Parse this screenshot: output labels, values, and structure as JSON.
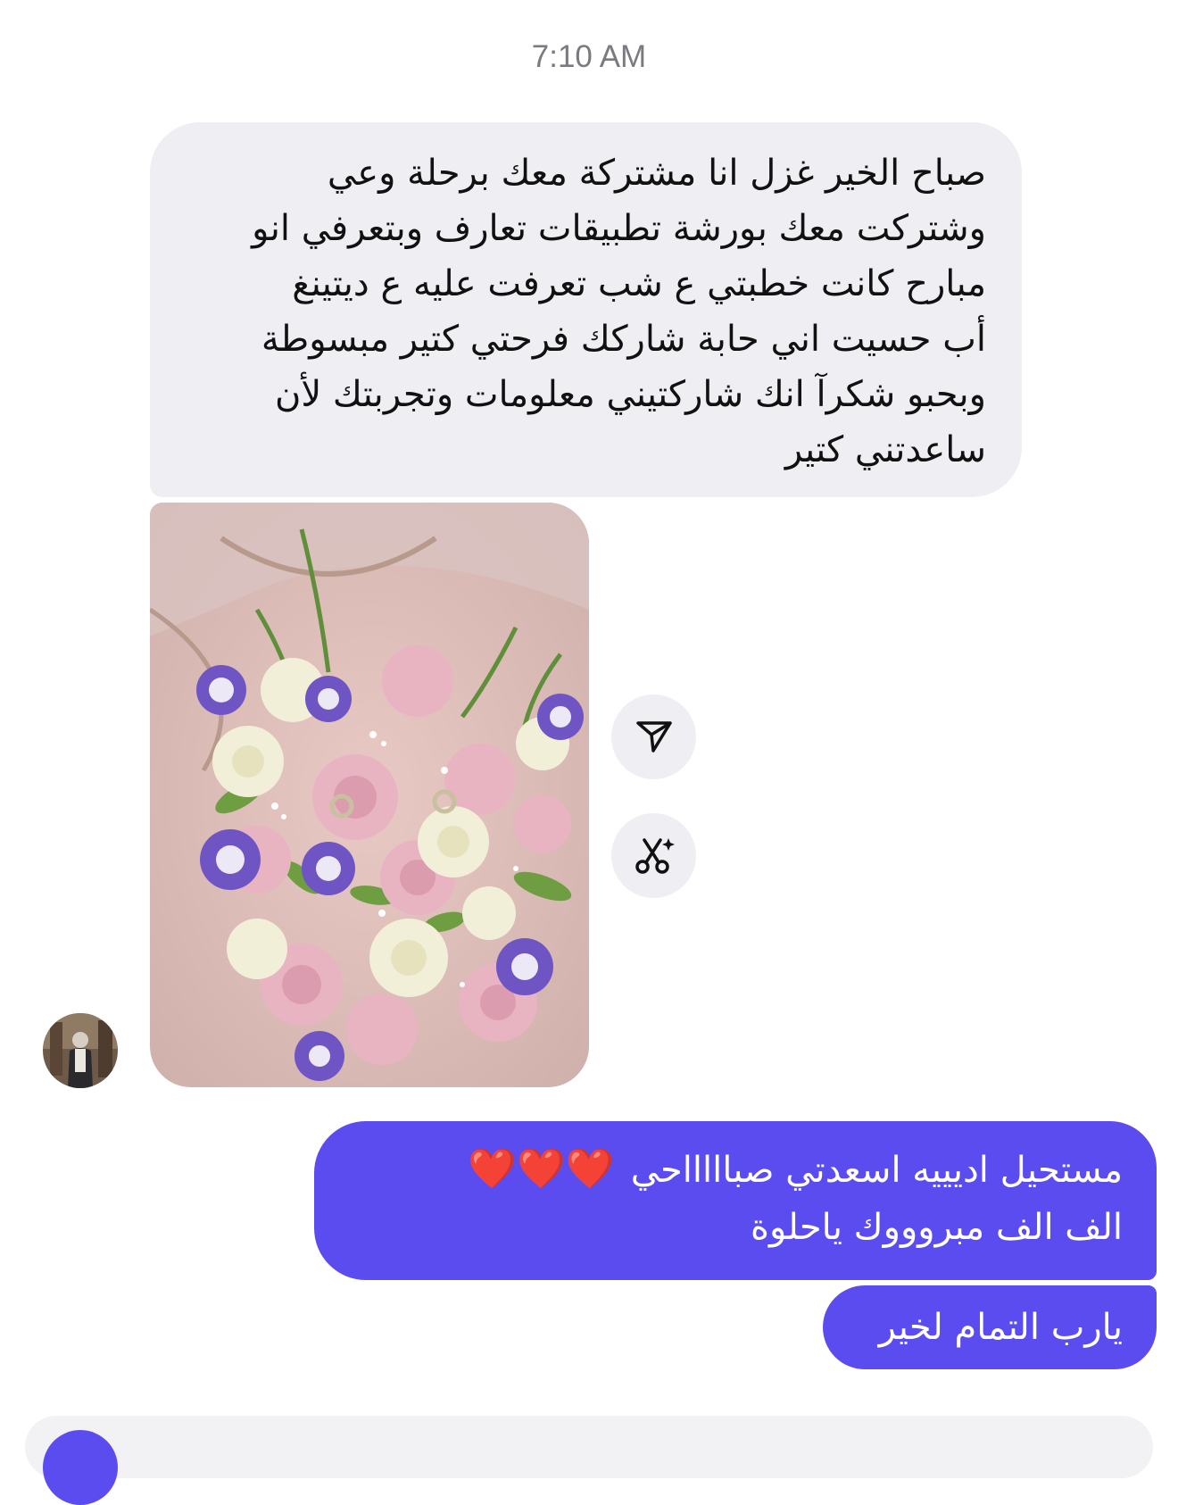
{
  "chat": {
    "timestamp": "7:10 AM",
    "incoming_message": {
      "lines": [
        "صباح الخير غزل انا مشتركة معك برحلة وعي",
        "وشتركت معك بورشة تطبيقات تعارف وبتعرفي انو",
        "مبارح كانت خطبتي ع شب تعرفت عليه ع ديتينغ",
        "أب حسيت اني حابة شاركك فرحتي كتير مبسوطة",
        "وبحبو شكرآ انك شاركتيني معلومات وتجربتك لأن",
        "ساعدتني كتير"
      ]
    },
    "incoming_photo": {
      "description_icon": "flower-bouquet-photo"
    },
    "actions": {
      "share_icon": "paper-plane-icon",
      "remix_icon": "scissors-sparkle-icon"
    },
    "sender_avatar_icon": "profile-avatar",
    "outgoing_messages": [
      {
        "line1": "مستحيل اديييه اسعدتي صباااااحي",
        "hearts": "❤️❤️❤️",
        "line2": "الف الف مبروووك ياحلوة"
      },
      {
        "text": "يارب التمام لخير"
      }
    ],
    "colors": {
      "outgoing_bubble": "#5b4cf0",
      "incoming_bubble": "#efeff3",
      "timestamp": "#7a7a80",
      "heart": "#e8291d"
    }
  }
}
